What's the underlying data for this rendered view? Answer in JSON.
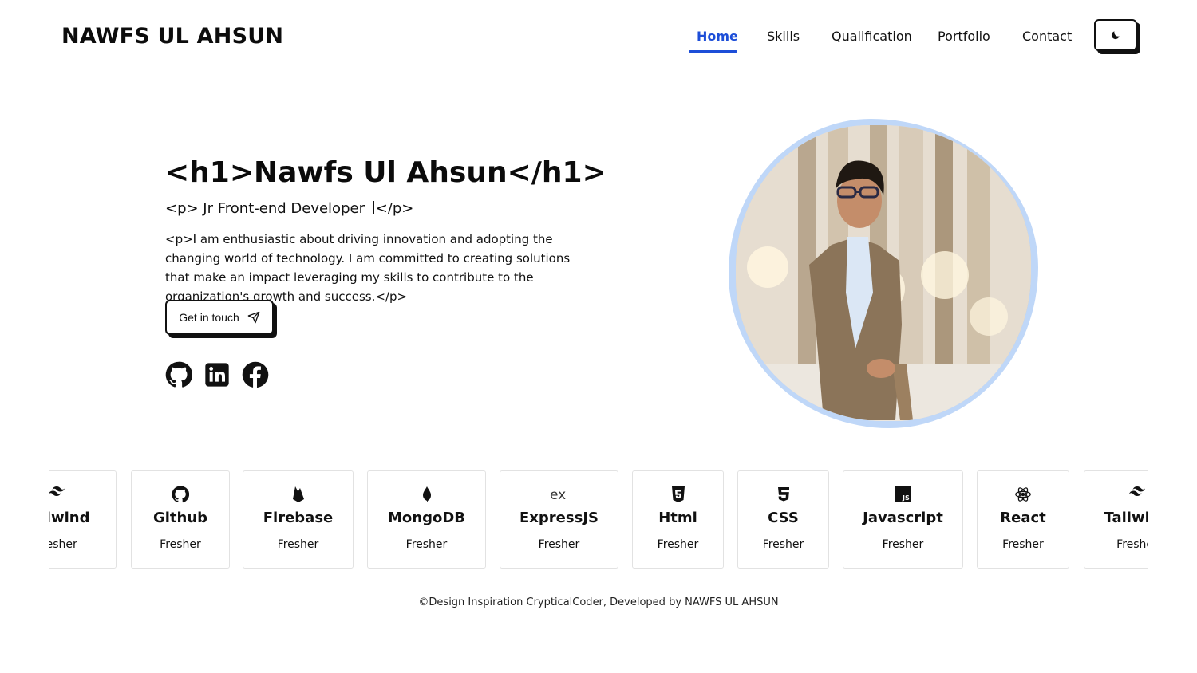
{
  "header": {
    "brand": "NAWFS UL AHSUN",
    "nav": [
      {
        "label": "Home",
        "active": true
      },
      {
        "label": "Skills",
        "active": false
      },
      {
        "label": "Qualification",
        "active": false
      },
      {
        "label": "Portfolio",
        "active": false
      },
      {
        "label": "Contact",
        "active": false
      }
    ],
    "theme_toggle_icon": "moon-icon"
  },
  "hero": {
    "title": "<h1>Nawfs Ul Ahsun</h1>",
    "role_prefix": "<p> Jr Front-end Developer ",
    "role_suffix": "</p>",
    "description": "<p>I am enthusiastic about driving innovation and adopting the changing world of technology. I am committed to creating solutions that make an impact leveraging my skills to contribute to the organization's growth and success.</p>",
    "cta_label": "Get in touch",
    "cta_icon": "send-icon",
    "socials": [
      "github-icon",
      "linkedin-icon",
      "facebook-icon"
    ]
  },
  "skills": [
    {
      "name": "Tailwind",
      "level": "Fresher",
      "icon": "tailwind-icon"
    },
    {
      "name": "Github",
      "level": "Fresher",
      "icon": "github-icon"
    },
    {
      "name": "Firebase",
      "level": "Fresher",
      "icon": "firebase-icon"
    },
    {
      "name": "MongoDB",
      "level": "Fresher",
      "icon": "mongodb-icon"
    },
    {
      "name": "ExpressJS",
      "level": "Fresher",
      "icon": "express-icon"
    },
    {
      "name": "Html",
      "level": "Fresher",
      "icon": "html5-icon"
    },
    {
      "name": "CSS",
      "level": "Fresher",
      "icon": "css3-icon"
    },
    {
      "name": "Javascript",
      "level": "Fresher",
      "icon": "javascript-icon"
    },
    {
      "name": "React",
      "level": "Fresher",
      "icon": "react-icon"
    },
    {
      "name": "Tailwind",
      "level": "Fresher",
      "icon": "tailwind-icon"
    }
  ],
  "footer": {
    "text": "©Design Inspiration CrypticalCoder, Developed by NAWFS UL AHSUN"
  },
  "colors": {
    "accent": "#1d4ed8",
    "portrait_ring": "#bfd7f8",
    "text": "#111111"
  }
}
